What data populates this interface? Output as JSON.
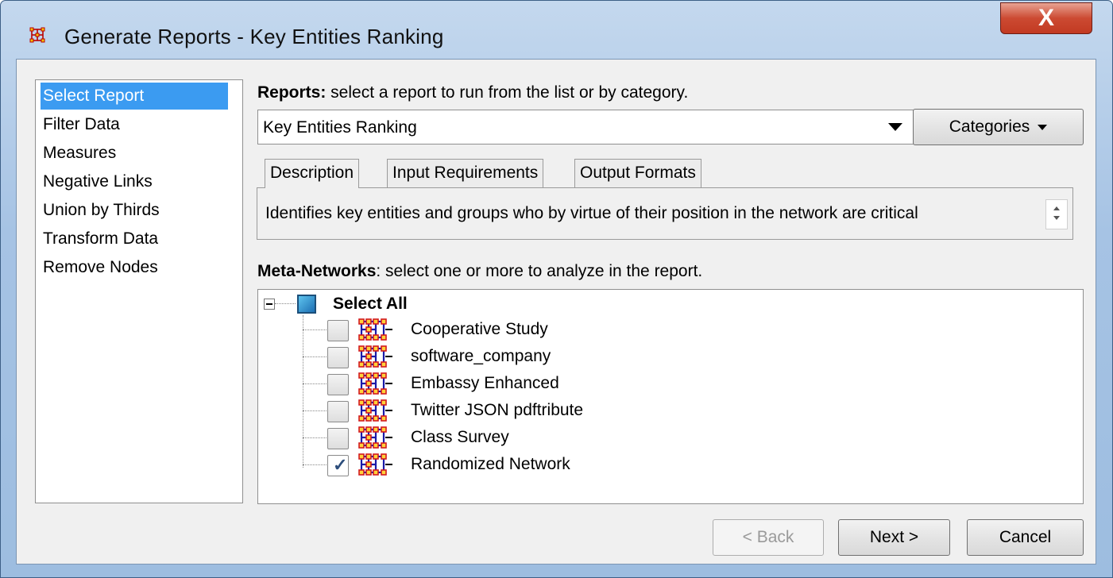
{
  "window": {
    "title": "Generate Reports - Key Entities Ranking",
    "close_label": "X",
    "app_icon": "network-grid-icon",
    "accent_color": "#3b9bf1"
  },
  "sidebar": {
    "items": [
      {
        "label": "Select Report",
        "selected": true
      },
      {
        "label": "Filter Data",
        "selected": false
      },
      {
        "label": "Measures",
        "selected": false
      },
      {
        "label": "Negative Links",
        "selected": false
      },
      {
        "label": "Union by Thirds",
        "selected": false
      },
      {
        "label": "Transform Data",
        "selected": false
      },
      {
        "label": "Remove Nodes",
        "selected": false
      }
    ]
  },
  "reports": {
    "label_bold": "Reports:",
    "label_rest": " select a report to run from the list or by category.",
    "selected": "Key Entities Ranking",
    "categories_label": "Categories"
  },
  "tabs": [
    {
      "label": "Description",
      "active": true
    },
    {
      "label": "Input Requirements",
      "active": false
    },
    {
      "label": "Output Formats",
      "active": false
    }
  ],
  "description": "Identifies key entities and groups who by virtue of their position in the network are critical",
  "meta_networks": {
    "label_bold": "Meta-Networks",
    "label_rest": ": select one or more to analyze in the report.",
    "select_all_label": "Select All",
    "items": [
      {
        "label": "Cooperative Study",
        "checked": false
      },
      {
        "label": "software_company",
        "checked": false
      },
      {
        "label": "Embassy Enhanced",
        "checked": false
      },
      {
        "label": "Twitter JSON pdftribute",
        "checked": false
      },
      {
        "label": "Class Survey",
        "checked": false
      },
      {
        "label": "Randomized Network",
        "checked": true
      }
    ]
  },
  "footer": {
    "back_label": "< Back",
    "next_label": "Next >",
    "cancel_label": "Cancel",
    "back_enabled": false
  }
}
